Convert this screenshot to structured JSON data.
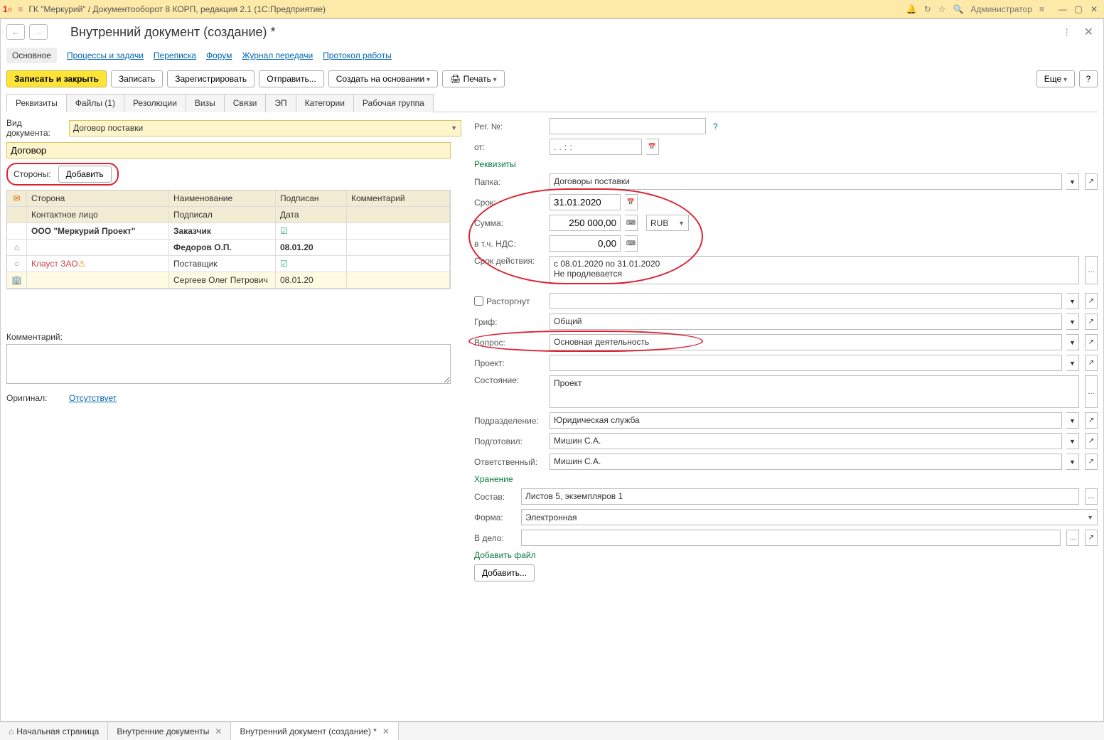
{
  "titlebar": {
    "app_title": "ГК \"Меркурий\" / Документооборот 8 КОРП, редакция 2.1  (1С:Предприятие)",
    "user": "Администратор"
  },
  "page": {
    "title": "Внутренний документ (создание) *"
  },
  "nav_links": {
    "main": "Основное",
    "processes": "Процессы и задачи",
    "correspondence": "Переписка",
    "forum": "Форум",
    "transfer_journal": "Журнал передачи",
    "work_protocol": "Протокол работы"
  },
  "cmdbar": {
    "save_close": "Записать и закрыть",
    "save": "Записать",
    "register": "Зарегистрировать",
    "send": "Отправить...",
    "create_based": "Создать на основании",
    "print": "Печать",
    "more": "Еще",
    "help": "?"
  },
  "tabs": {
    "requisites": "Реквизиты",
    "files": "Файлы (1)",
    "resolutions": "Резолюции",
    "visas": "Визы",
    "links": "Связи",
    "ep": "ЭП",
    "categories": "Категории",
    "workgroup": "Рабочая группа"
  },
  "left": {
    "doc_type_label": "Вид документа:",
    "doc_type_value": "Договор поставки",
    "title_value": "Договор",
    "parties_label": "Стороны:",
    "add_btn": "Добавить",
    "table_headers": {
      "party": "Сторона",
      "name": "Наименование",
      "signed": "Подписан",
      "comment": "Комментарий",
      "contact": "Контактное лицо",
      "signed_by": "Подписал",
      "date": "Дата"
    },
    "rows": [
      {
        "party": "ООО \"Меркурий Проект\"",
        "name": "Заказчик",
        "signed": true,
        "party_bold": true
      },
      {
        "contact": "",
        "signed_by": "Федоров О.П.",
        "date": "08.01.20",
        "sub": true
      },
      {
        "party": "Клауст ЗАО",
        "name": "Поставщик",
        "signed": true,
        "warning": true
      },
      {
        "contact": "",
        "signed_by": "Сергеев Олег Петрович",
        "date": "08.01.20",
        "sub": true,
        "alt": true
      }
    ],
    "comment_label": "Комментарий:",
    "original_label": "Оригинал:",
    "original_value": "Отсутствует"
  },
  "right": {
    "reg_no_label": "Рег. №:",
    "from_label": "от:",
    "from_placeholder": ". . : :",
    "section_req": "Реквизиты",
    "folder_label": "Папка:",
    "folder_value": "Договоры поставки",
    "term_label": "Срок:",
    "term_value": "31.01.2020",
    "sum_label": "Сумма:",
    "sum_value": "250 000,00",
    "currency": "RUB",
    "vat_label": "в т.ч. НДС:",
    "vat_value": "0,00",
    "validity_label": "Срок действия:",
    "validity_value": "с 08.01.2020 по 31.01.2020\nНе продлевается",
    "terminated_label": "Расторгнут",
    "stamp_label": "Гриф:",
    "stamp_value": "Общий",
    "question_label": "Вопрос:",
    "question_value": "Основная деятельность",
    "project_label": "Проект:",
    "state_label": "Состояние:",
    "state_value": "Проект",
    "dept_label": "Подразделение:",
    "dept_value": "Юридическая служба",
    "prepared_label": "Подготовил:",
    "prepared_value": "Мишин С.А.",
    "resp_label": "Ответственный:",
    "resp_value": "Мишин С.А.",
    "section_storage": "Хранение",
    "content_label": "Состав:",
    "content_value": "Листов 5, экземпляров 1",
    "form_label": "Форма:",
    "form_value": "Электронная",
    "case_label": "В дело:",
    "section_addfile": "Добавить файл",
    "addfile_btn": "Добавить..."
  },
  "bottom_tabs": {
    "home": "Начальная страница",
    "docs": "Внутренние документы",
    "current": "Внутренний документ (создание) *"
  }
}
